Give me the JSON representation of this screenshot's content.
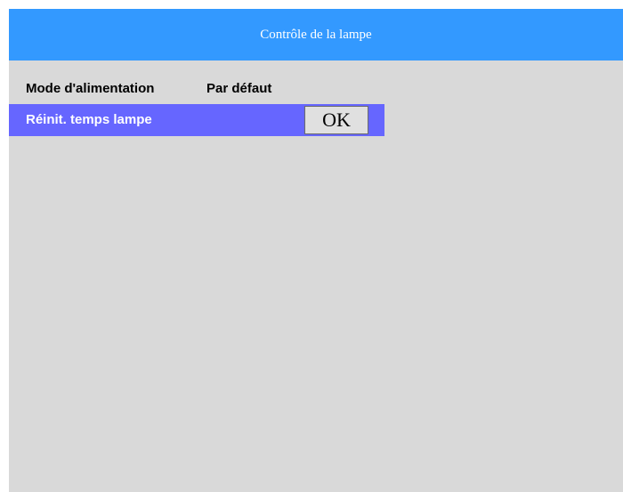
{
  "header": {
    "title": "Contrôle de la lampe"
  },
  "menu": {
    "power_mode": {
      "label": "Mode d'alimentation",
      "value": "Par défaut"
    },
    "lamp_reset": {
      "label": "Réinit. temps lampe",
      "button_label": "OK"
    }
  },
  "colors": {
    "header_bg": "#3399ff",
    "selected_row_bg": "#6666ff",
    "panel_bg": "#d9d9d9"
  }
}
